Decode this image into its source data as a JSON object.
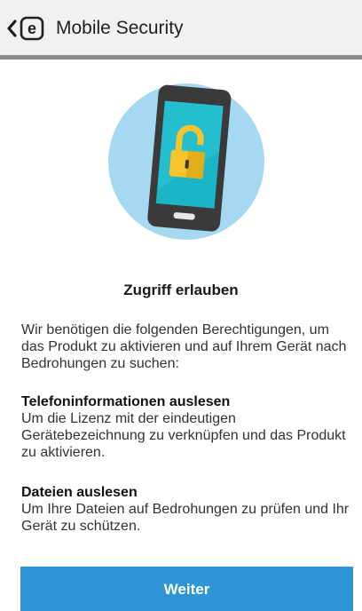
{
  "appbar": {
    "title": "Mobile Security",
    "back_icon": "chevron-left-icon",
    "logo_letter": "e"
  },
  "hero": {
    "icon": "phone-unlocked-padlock-icon",
    "colors": {
      "circle": "#a6d8f2",
      "phone_body": "#3a3a3a",
      "screen": "#1ab6c8",
      "padlock": "#f7c52b"
    }
  },
  "content": {
    "heading": "Zugriff erlauben",
    "intro": "Wir benötigen die folgenden Berechtigungen, um das Produkt zu aktivieren und auf Ihrem Gerät nach Bedrohungen zu suchen:",
    "permissions": [
      {
        "title": "Telefoninformationen auslesen",
        "description": "Um die Lizenz mit der eindeutigen Gerätebezeichnung zu verknüpfen und das Produkt zu aktivieren."
      },
      {
        "title": "Dateien auslesen",
        "description": "Um Ihre Dateien auf Bedrohungen zu prüfen und Ihr Gerät zu schützen."
      }
    ]
  },
  "actions": {
    "continue_label": "Weiter",
    "continue_color": "#2f95d6"
  }
}
